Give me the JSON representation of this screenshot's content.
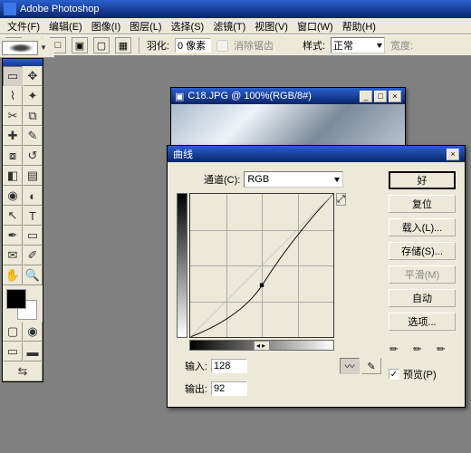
{
  "app": {
    "title": "Adobe Photoshop"
  },
  "menu": {
    "file": "文件(F)",
    "edit": "编辑(E)",
    "image": "图像(I)",
    "layer": "图层(L)",
    "select": "选择(S)",
    "filter": "滤镜(T)",
    "view": "视图(V)",
    "window": "窗口(W)",
    "help": "帮助(H)"
  },
  "options": {
    "feather_label": "羽化:",
    "feather_value": "0 像素",
    "antialias_label": "消除锯齿",
    "style_label": "样式:",
    "style_value": "正常",
    "width_label": "宽度:"
  },
  "document": {
    "title": "C18.JPG @ 100%(RGB/8#)"
  },
  "curves": {
    "title": "曲线",
    "channel_label": "通道(C):",
    "channel_value": "RGB",
    "input_label": "输入:",
    "input_value": "128",
    "output_label": "输出:",
    "output_value": "92",
    "buttons": {
      "ok": "好",
      "cancel": "复位",
      "load": "载入(L)...",
      "save": "存储(S)...",
      "smooth": "平滑(M)",
      "auto": "自动",
      "options": "选项..."
    },
    "preview_label": "预览(P)"
  },
  "chart_data": {
    "type": "line",
    "title": "曲线",
    "xlabel": "输入",
    "ylabel": "输出",
    "xlim": [
      0,
      255
    ],
    "ylim": [
      0,
      255
    ],
    "series": [
      {
        "name": "RGB",
        "points": [
          [
            0,
            0
          ],
          [
            64,
            28
          ],
          [
            128,
            92
          ],
          [
            192,
            168
          ],
          [
            255,
            255
          ]
        ]
      }
    ],
    "marker": {
      "x": 128,
      "y": 92
    }
  }
}
